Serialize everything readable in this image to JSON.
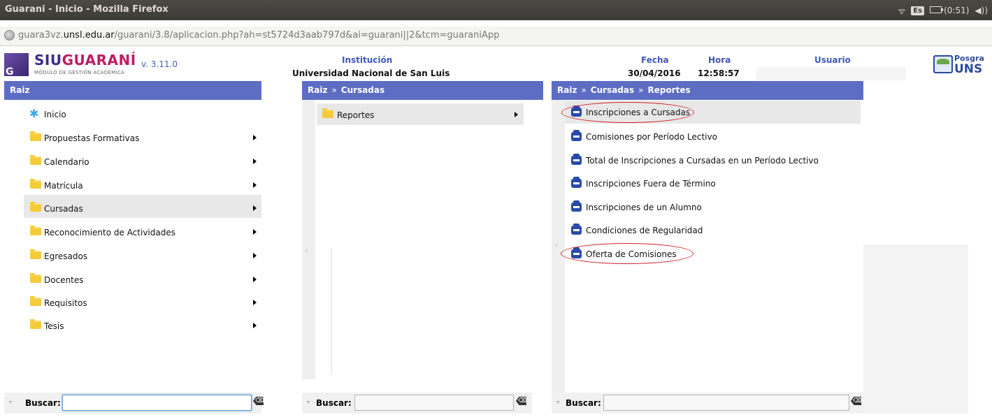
{
  "window": {
    "title": "Guarani - Inicio - Mozilla Firefox",
    "tray": {
      "lang": "Es",
      "battery": "(0:51)",
      "volume_glyph": "◀))",
      "wifi_glyph": "ᯤ"
    }
  },
  "browser": {
    "url_prefix": "guara3vz.",
    "url_host": "unsl.edu.ar",
    "url_rest": "/guarani/3.8/aplicacion.php?ah=st5724d3aab797d&ai=guarani||2&tcm=guaraniApp"
  },
  "header": {
    "logo_part1": "SIU",
    "logo_part2": "GUARANÍ",
    "version": "v. 3.11.0",
    "subtitle": "MÓDULO DE GESTIÓN ACADÉMICA",
    "institucion_label": "Institución",
    "institucion_value": "Universidad Nacional de San Luis",
    "fecha_label": "Fecha",
    "fecha_value": "30/04/2016",
    "hora_label": "Hora",
    "hora_value": "12:58:57",
    "usuario_label": "Usuario",
    "usuario_value": "",
    "posgrado_line1": "Posgra",
    "posgrado_line2": "UNS"
  },
  "panel_left": {
    "title": "Raiz",
    "items": [
      {
        "label": "Inicio"
      },
      {
        "label": "Propuestas Formativas"
      },
      {
        "label": "Calendario"
      },
      {
        "label": "Matrícula"
      },
      {
        "label": "Cursadas"
      },
      {
        "label": "Reconocimiento de Actividades"
      },
      {
        "label": "Egresados"
      },
      {
        "label": "Docentes"
      },
      {
        "label": "Requisitos"
      },
      {
        "label": "Tesis"
      }
    ],
    "search_label": "Buscar:",
    "search_value": ""
  },
  "panel_mid": {
    "crumb1": "Raiz",
    "crumb2": "Cursadas",
    "crumb_sep": "»",
    "items": [
      {
        "label": "Reportes"
      }
    ],
    "search_label": "Buscar:",
    "search_value": ""
  },
  "panel_right": {
    "crumb1": "Raiz",
    "crumb2": "Cursadas",
    "crumb3": "Reportes",
    "crumb_sep": "»",
    "items": [
      {
        "label": "Inscripciones a Cursadas"
      },
      {
        "label": "Comisiones por Período Lectivo"
      },
      {
        "label": "Total de Inscripciones a Cursadas en un Período Lectivo"
      },
      {
        "label": "Inscripciones Fuera de Término"
      },
      {
        "label": "Inscripciones de un Alumno"
      },
      {
        "label": "Condiciones de Regularidad"
      },
      {
        "label": "Oferta de Comisiones"
      }
    ],
    "search_label": "Buscar:",
    "search_value": ""
  },
  "icons": {
    "clear": "⌫"
  },
  "colors": {
    "panel_header": "#5e6dc4",
    "annotation": "#d2232a",
    "brand_purple": "#3d2d8c",
    "brand_magenta": "#c01d63"
  }
}
